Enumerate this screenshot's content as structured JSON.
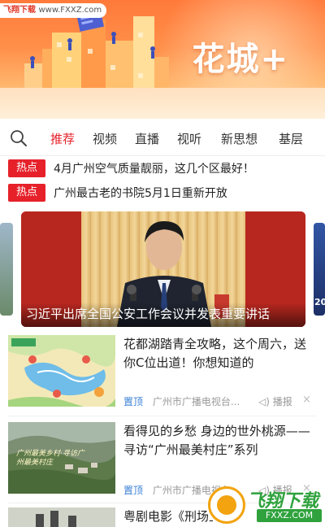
{
  "banner": {
    "brand_text": "花城+",
    "watermark_main": "飞翔下载",
    "watermark_url": "www.FXXZ.com"
  },
  "tabs": [
    {
      "label": "推荐",
      "active": true
    },
    {
      "label": "视频",
      "active": false
    },
    {
      "label": "直播",
      "active": false
    },
    {
      "label": "视听",
      "active": false
    },
    {
      "label": "新思想",
      "active": false
    },
    {
      "label": "基层",
      "active": false
    }
  ],
  "search": {
    "icon": "search-icon"
  },
  "hot_news": [
    {
      "badge": "热点",
      "text": "4月广州空气质量靓丽，这几个区最好！"
    },
    {
      "badge": "热点",
      "text": "广州最古老的书院5月1日重新开放"
    }
  ],
  "carousel": {
    "main_caption": "习近平出席全国公安工作会议并发表重要讲话",
    "right_card_text": "20"
  },
  "news": [
    {
      "title": "花都湖踏青全攻略，这个周六，送你C位出道！你想知道的",
      "pin": "置顶",
      "source": "广州市广播电视台...",
      "play": "播报",
      "close": "×"
    },
    {
      "title": "看得见的乡愁 身边的世外桃源——寻访“广州最美村庄”系列",
      "pin": "置顶",
      "source": "广州市广播电视台...",
      "play": "播报",
      "close": "×",
      "thumb_text": "广州最美乡村·寻访广州最美村庄"
    },
    {
      "title": "粤剧电影《刑场上的婚礼》"
    }
  ],
  "corner_logo": {
    "text": "飞翔下载",
    "site": "FXXZ.COM"
  },
  "colors": {
    "accent": "#e6212a",
    "pin": "#3a7fd6",
    "banner": "#ff7a3a"
  }
}
